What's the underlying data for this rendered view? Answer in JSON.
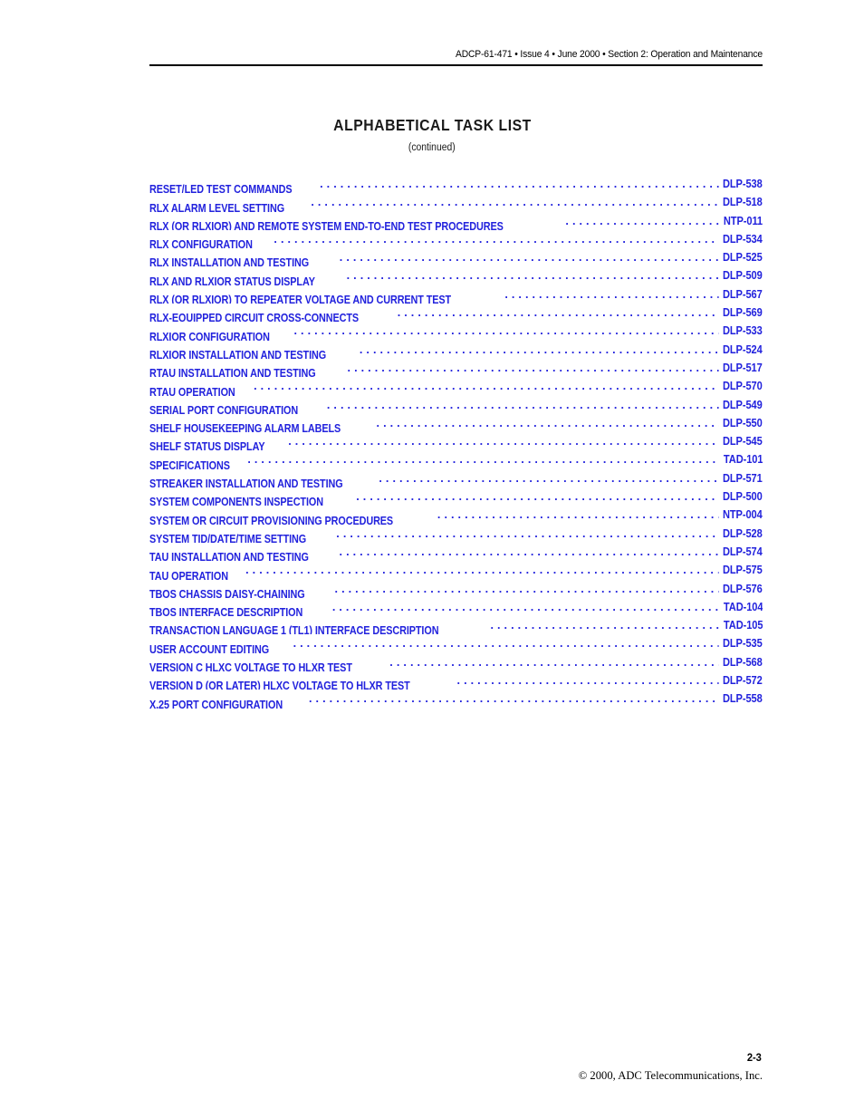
{
  "header": {
    "running_head": "ADCP-61-471 • Issue 4 • June 2000 • Section 2: Operation and Maintenance"
  },
  "title": {
    "main": "ALPHABETICAL TASK LIST",
    "subtitle": "(continued)"
  },
  "colors": {
    "entry_blue": "#2222dd",
    "text_black": "#000000"
  },
  "task_list": [
    {
      "label": "RESET/LED TEST COMMANDS",
      "code": "DLP-538"
    },
    {
      "label": "RLX ALARM LEVEL SETTING",
      "code": "DLP-518"
    },
    {
      "label": "RLX (OR RLXIOR) AND REMOTE SYSTEM END-TO-END TEST PROCEDURES",
      "code": "NTP-011"
    },
    {
      "label": "RLX CONFIGURATION",
      "code": "DLP-534"
    },
    {
      "label": "RLX INSTALLATION AND TESTING",
      "code": "DLP-525"
    },
    {
      "label": "RLX AND RLXIOR STATUS DISPLAY",
      "code": "DLP-509"
    },
    {
      "label": "RLX (OR RLXIOR) TO REPEATER VOLTAGE AND CURRENT TEST",
      "code": "DLP-567"
    },
    {
      "label": "RLX-EQUIPPED CIRCUIT CROSS-CONNECTS",
      "code": "DLP-569"
    },
    {
      "label": "RLXIOR CONFIGURATION",
      "code": "DLP-533"
    },
    {
      "label": "RLXIOR INSTALLATION AND TESTING",
      "code": "DLP-524"
    },
    {
      "label": "RTAU INSTALLATION AND TESTING",
      "code": "DLP-517"
    },
    {
      "label": "RTAU OPERATION",
      "code": "DLP-570"
    },
    {
      "label": "SERIAL PORT CONFIGURATION",
      "code": "DLP-549"
    },
    {
      "label": "SHELF HOUSEKEEPING ALARM LABELS",
      "code": "DLP-550"
    },
    {
      "label": "SHELF STATUS DISPLAY",
      "code": "DLP-545"
    },
    {
      "label": "SPECIFICATIONS",
      "code": "TAD-101"
    },
    {
      "label": "STREAKER INSTALLATION AND TESTING",
      "code": "DLP-571"
    },
    {
      "label": "SYSTEM COMPONENTS INSPECTION",
      "code": "DLP-500"
    },
    {
      "label": "SYSTEM OR CIRCUIT PROVISIONING PROCEDURES",
      "code": "NTP-004"
    },
    {
      "label": "SYSTEM TID/DATE/TIME SETTING",
      "code": "DLP-528"
    },
    {
      "label": "TAU INSTALLATION AND TESTING",
      "code": "DLP-574"
    },
    {
      "label": "TAU OPERATION",
      "code": "DLP-575"
    },
    {
      "label": "TBOS CHASSIS DAISY-CHAINING",
      "code": "DLP-576"
    },
    {
      "label": "TBOS INTERFACE DESCRIPTION",
      "code": "TAD-104"
    },
    {
      "label": "TRANSACTION LANGUAGE 1 (TL1) INTERFACE DESCRIPTION",
      "code": "TAD-105"
    },
    {
      "label": "USER ACCOUNT EDITING",
      "code": "DLP-535"
    },
    {
      "label": "VERSION C HLXC VOLTAGE TO HLXR TEST",
      "code": "DLP-568"
    },
    {
      "label": "VERSION D (OR LATER) HLXC VOLTAGE TO HLXR TEST",
      "code": "DLP-572"
    },
    {
      "label": "X.25 PORT CONFIGURATION",
      "code": "DLP-558"
    }
  ],
  "footer": {
    "page_number": "2-3",
    "copyright": "© 2000, ADC Telecommunications, Inc."
  }
}
